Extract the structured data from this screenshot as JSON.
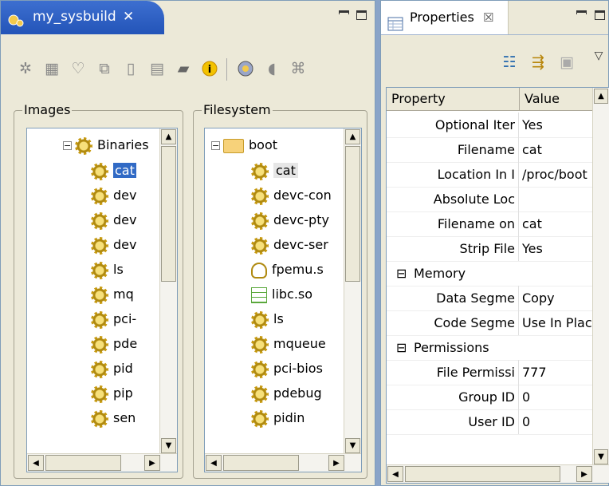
{
  "left_view": {
    "tab_title": "my_sysbuild",
    "tab_close": "✕",
    "toolbar_icons": [
      "gears-icon",
      "grid-icon",
      "plug-icon",
      "copy-icon",
      "new-file-icon",
      "document-icon",
      "folder-icon",
      "info-icon",
      "disc-icon",
      "speaker-icon",
      "crossed-icon"
    ],
    "images": {
      "title": "Images",
      "root": "Binaries",
      "items": [
        "cat",
        "dev",
        "dev",
        "dev",
        "ls",
        "mq",
        "pci-",
        "pde",
        "pid",
        "pip",
        "sen"
      ]
    },
    "filesystem": {
      "title": "Filesystem",
      "root": "boot",
      "items": [
        {
          "label": "cat",
          "icon": "gear"
        },
        {
          "label": "devc-con",
          "icon": "gear"
        },
        {
          "label": "devc-pty",
          "icon": "gear"
        },
        {
          "label": "devc-ser",
          "icon": "gear"
        },
        {
          "label": "fpemu.s",
          "icon": "plug"
        },
        {
          "label": "libc.so",
          "icon": "lib"
        },
        {
          "label": "ls",
          "icon": "gear"
        },
        {
          "label": "mqueue",
          "icon": "gear"
        },
        {
          "label": "pci-bios",
          "icon": "gear"
        },
        {
          "label": "pdebug",
          "icon": "gear"
        },
        {
          "label": "pidin",
          "icon": "gear"
        }
      ]
    }
  },
  "properties_view": {
    "tab_title": "Properties",
    "tab_close": "☒",
    "columns": [
      "Property",
      "Value"
    ],
    "rows": [
      {
        "type": "prop",
        "name": "Optional Iter",
        "value": "Yes"
      },
      {
        "type": "prop",
        "name": "Filename",
        "value": "cat"
      },
      {
        "type": "prop",
        "name": "Location In I",
        "value": "/proc/boot"
      },
      {
        "type": "prop",
        "name": "Absolute Loc",
        "value": ""
      },
      {
        "type": "prop",
        "name": "Filename on",
        "value": "cat"
      },
      {
        "type": "prop",
        "name": "Strip File",
        "value": "Yes"
      },
      {
        "type": "cat",
        "name": "Memory",
        "expander": "⊟"
      },
      {
        "type": "prop",
        "name": "Data Segme",
        "value": "Copy"
      },
      {
        "type": "prop",
        "name": "Code Segme",
        "value": "Use In Place"
      },
      {
        "type": "cat",
        "name": "Permissions",
        "expander": "⊟"
      },
      {
        "type": "prop",
        "name": "File Permissi",
        "value": "777"
      },
      {
        "type": "prop",
        "name": "Group ID",
        "value": "0"
      },
      {
        "type": "prop",
        "name": "User ID",
        "value": "0"
      }
    ]
  },
  "colors": {
    "active_tab": "#2354b8",
    "selection": "#316ac5",
    "panel_bg": "#ece9d8"
  }
}
